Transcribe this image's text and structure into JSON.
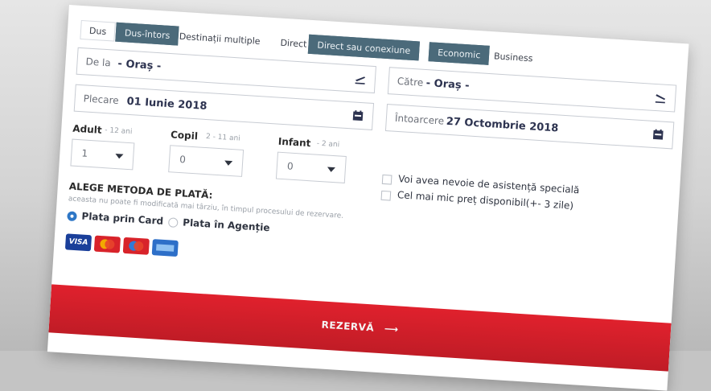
{
  "trip_tabs": [
    {
      "label": "Dus",
      "active": false
    },
    {
      "label": "Dus-întors",
      "active": true
    },
    {
      "label": "Destinații multiple",
      "active": false
    }
  ],
  "connection_tabs": [
    {
      "label": "Direct",
      "active": false
    },
    {
      "label": "Direct sau conexiune",
      "active": true
    }
  ],
  "class_tabs": [
    {
      "label": "Economic",
      "active": true
    },
    {
      "label": "Business",
      "active": false
    }
  ],
  "from": {
    "label": "De la",
    "value": "- Oraș -",
    "icon": "plane-takeoff-icon"
  },
  "to": {
    "label": "Către",
    "value": "- Oraș -",
    "icon": "plane-landing-icon"
  },
  "departure": {
    "label": "Plecare",
    "value": "01 Iunie 2018",
    "icon": "calendar-icon"
  },
  "return": {
    "label": "Întoarcere",
    "value": "27 Octombrie 2018",
    "icon": "calendar-icon"
  },
  "passengers": {
    "adult": {
      "label": "Adult",
      "hint": "- 12 ani",
      "value": "1"
    },
    "child": {
      "label": "Copil",
      "hint": "2 - 11 ani",
      "value": "0"
    },
    "infant": {
      "label": "Infant",
      "hint": "- 2 ani",
      "value": "0"
    }
  },
  "options": {
    "special_assistance": "Voi avea nevoie de asistență specială",
    "lowest_price": "Cel mai mic preț disponibil(+- 3 zile)"
  },
  "payment": {
    "title": "ALEGE METODA DE PLATĂ:",
    "note": "aceasta nu poate fi modificată mai târziu, în timpul procesului de rezervare.",
    "card_label": "Plata prin Card",
    "agency_label": "Plata în Agenție",
    "selected": "card",
    "cards": [
      {
        "name": "visa-icon",
        "text": "VISA",
        "color": "#1a3f9a"
      },
      {
        "name": "mastercard-icon",
        "text": "",
        "color": "#d8232a"
      },
      {
        "name": "maestro-icon",
        "text": "",
        "color": "#d8232a"
      },
      {
        "name": "amex-icon",
        "text": "",
        "color": "#2d6fc8"
      }
    ]
  },
  "submit": {
    "label": "REZERVĂ",
    "arrow": "⟶"
  },
  "colors": {
    "accent": "#4b6a7a",
    "submit": "#d81e2a"
  }
}
